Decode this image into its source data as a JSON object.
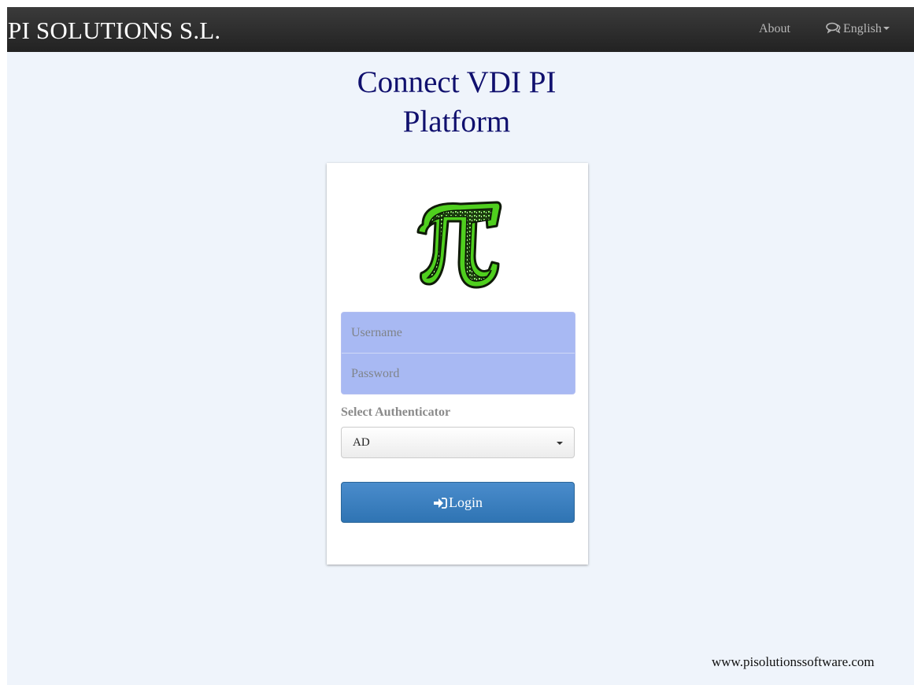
{
  "navbar": {
    "brand": "PI SOLUTIONS S.L.",
    "about_label": "About",
    "language_label": "English",
    "language_icon": "comment-bubbles-icon"
  },
  "main": {
    "title_line1": "Connect VDI PI",
    "title_line2": "Platform"
  },
  "login_form": {
    "logo_icon": "pi-symbol-logo",
    "username": {
      "value": "",
      "placeholder": "Username"
    },
    "password": {
      "value": "",
      "placeholder": "Password"
    },
    "authenticator_label": "Select Authenticator",
    "authenticator_selected": "AD",
    "login_icon": "sign-in-icon",
    "login_label": "Login"
  },
  "footer": {
    "url_text": "www.pisolutionssoftware.com"
  },
  "colors": {
    "navbar_bg": "#222222",
    "page_bg": "#eff4fb",
    "title_color": "#10106e",
    "input_bg": "#a8b9f3",
    "login_button": "#337ab7",
    "logo_green": "#4fcf1e"
  }
}
